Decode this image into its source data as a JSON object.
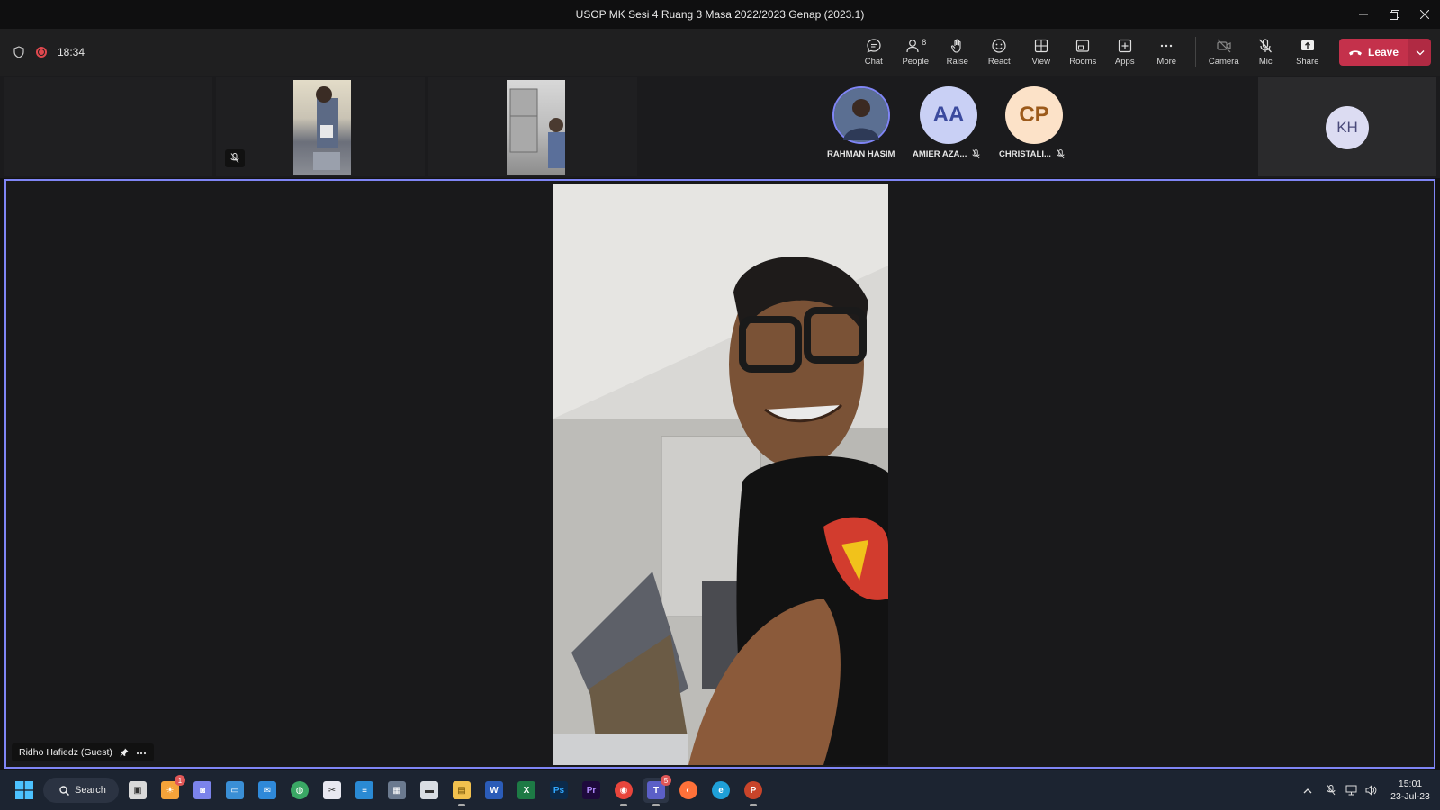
{
  "window": {
    "title": "USOP MK Sesi 4 Ruang 3 Masa 2022/2023 Genap (2023.1)"
  },
  "meeting": {
    "elapsed": "18:34"
  },
  "toolbar": {
    "chat": "Chat",
    "people": "People",
    "people_count": "8",
    "raise": "Raise",
    "react": "React",
    "view": "View",
    "rooms": "Rooms",
    "apps": "Apps",
    "more": "More",
    "camera": "Camera",
    "mic": "Mic",
    "share": "Share",
    "leave": "Leave"
  },
  "participants": [
    {
      "initials": "",
      "name": "RAHMAN HASIM",
      "muted": false
    },
    {
      "initials": "AA",
      "name": "AMIER AZA...",
      "muted": true,
      "color": "#c9d0f5",
      "text_color": "#3b4a9e"
    },
    {
      "initials": "CP",
      "name": "CHRISTALI...",
      "muted": true,
      "color": "#fce2c8",
      "text_color": "#9c5a1a"
    },
    {
      "initials": "KH",
      "name": "",
      "muted": false,
      "color": "#dcdcf2",
      "text_color": "#4a4a7a"
    }
  ],
  "stage": {
    "speaker_name": "Ridho Hafiedz (Guest)"
  },
  "taskbar": {
    "search": "Search",
    "time": "15:01",
    "date": "23-Jul-23",
    "teams_badge": "5",
    "notification_badge": "1"
  },
  "colors": {
    "accent": "#7f85f5",
    "leave": "#c4314b",
    "recording": "#e0484e"
  }
}
